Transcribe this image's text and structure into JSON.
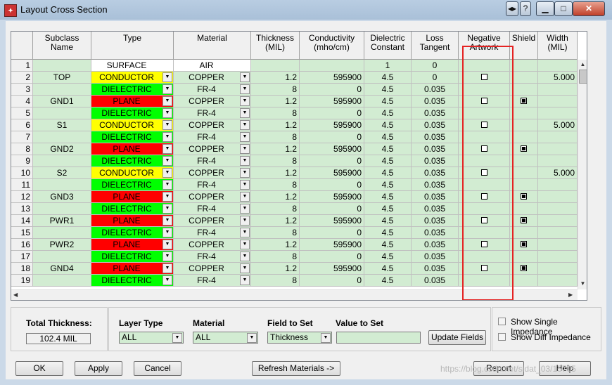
{
  "window": {
    "title": "Layout Cross Section"
  },
  "columns": [
    "Subclass Name",
    "Type",
    "Material",
    "Thickness\n(MIL)",
    "Conductivity\n(mho/cm)",
    "Dielectric\nConstant",
    "Loss\nTangent",
    "Negative\nArtwork",
    "Shield",
    "Width\n(MIL)"
  ],
  "rows": [
    {
      "n": "1",
      "name": "",
      "type": "SURFACE",
      "material": "AIR",
      "thick": "",
      "cond": "",
      "diel": "1",
      "loss": "0",
      "neg": null,
      "shield": null,
      "width": ""
    },
    {
      "n": "2",
      "name": "TOP",
      "type": "CONDUCTOR",
      "material": "COPPER",
      "thick": "1.2",
      "cond": "595900",
      "diel": "4.5",
      "loss": "0",
      "neg": false,
      "shield": null,
      "width": "5.000"
    },
    {
      "n": "3",
      "name": "",
      "type": "DIELECTRIC",
      "material": "FR-4",
      "thick": "8",
      "cond": "0",
      "diel": "4.5",
      "loss": "0.035",
      "neg": null,
      "shield": null,
      "width": ""
    },
    {
      "n": "4",
      "name": "GND1",
      "type": "PLANE",
      "material": "COPPER",
      "thick": "1.2",
      "cond": "595900",
      "diel": "4.5",
      "loss": "0.035",
      "neg": false,
      "shield": true,
      "width": ""
    },
    {
      "n": "5",
      "name": "",
      "type": "DIELECTRIC",
      "material": "FR-4",
      "thick": "8",
      "cond": "0",
      "diel": "4.5",
      "loss": "0.035",
      "neg": null,
      "shield": null,
      "width": ""
    },
    {
      "n": "6",
      "name": "S1",
      "type": "CONDUCTOR",
      "material": "COPPER",
      "thick": "1.2",
      "cond": "595900",
      "diel": "4.5",
      "loss": "0.035",
      "neg": false,
      "shield": null,
      "width": "5.000"
    },
    {
      "n": "7",
      "name": "",
      "type": "DIELECTRIC",
      "material": "FR-4",
      "thick": "8",
      "cond": "0",
      "diel": "4.5",
      "loss": "0.035",
      "neg": null,
      "shield": null,
      "width": ""
    },
    {
      "n": "8",
      "name": "GND2",
      "type": "PLANE",
      "material": "COPPER",
      "thick": "1.2",
      "cond": "595900",
      "diel": "4.5",
      "loss": "0.035",
      "neg": false,
      "shield": true,
      "width": ""
    },
    {
      "n": "9",
      "name": "",
      "type": "DIELECTRIC",
      "material": "FR-4",
      "thick": "8",
      "cond": "0",
      "diel": "4.5",
      "loss": "0.035",
      "neg": null,
      "shield": null,
      "width": ""
    },
    {
      "n": "10",
      "name": "S2",
      "type": "CONDUCTOR",
      "material": "COPPER",
      "thick": "1.2",
      "cond": "595900",
      "diel": "4.5",
      "loss": "0.035",
      "neg": false,
      "shield": null,
      "width": "5.000"
    },
    {
      "n": "11",
      "name": "",
      "type": "DIELECTRIC",
      "material": "FR-4",
      "thick": "8",
      "cond": "0",
      "diel": "4.5",
      "loss": "0.035",
      "neg": null,
      "shield": null,
      "width": ""
    },
    {
      "n": "12",
      "name": "GND3",
      "type": "PLANE",
      "material": "COPPER",
      "thick": "1.2",
      "cond": "595900",
      "diel": "4.5",
      "loss": "0.035",
      "neg": false,
      "shield": true,
      "width": ""
    },
    {
      "n": "13",
      "name": "",
      "type": "DIELECTRIC",
      "material": "FR-4",
      "thick": "8",
      "cond": "0",
      "diel": "4.5",
      "loss": "0.035",
      "neg": null,
      "shield": null,
      "width": ""
    },
    {
      "n": "14",
      "name": "PWR1",
      "type": "PLANE",
      "material": "COPPER",
      "thick": "1.2",
      "cond": "595900",
      "diel": "4.5",
      "loss": "0.035",
      "neg": false,
      "shield": true,
      "width": ""
    },
    {
      "n": "15",
      "name": "",
      "type": "DIELECTRIC",
      "material": "FR-4",
      "thick": "8",
      "cond": "0",
      "diel": "4.5",
      "loss": "0.035",
      "neg": null,
      "shield": null,
      "width": ""
    },
    {
      "n": "16",
      "name": "PWR2",
      "type": "PLANE",
      "material": "COPPER",
      "thick": "1.2",
      "cond": "595900",
      "diel": "4.5",
      "loss": "0.035",
      "neg": false,
      "shield": true,
      "width": ""
    },
    {
      "n": "17",
      "name": "",
      "type": "DIELECTRIC",
      "material": "FR-4",
      "thick": "8",
      "cond": "0",
      "diel": "4.5",
      "loss": "0.035",
      "neg": null,
      "shield": null,
      "width": ""
    },
    {
      "n": "18",
      "name": "GND4",
      "type": "PLANE",
      "material": "COPPER",
      "thick": "1.2",
      "cond": "595900",
      "diel": "4.5",
      "loss": "0.035",
      "neg": false,
      "shield": true,
      "width": ""
    },
    {
      "n": "19",
      "name": "",
      "type": "DIELECTRIC",
      "material": "FR-4",
      "thick": "8",
      "cond": "0",
      "diel": "4.5",
      "loss": "0.035",
      "neg": null,
      "shield": null,
      "width": ""
    }
  ],
  "bottom": {
    "total_label": "Total Thickness:",
    "total_value": "102.4 MIL",
    "layer_type_label": "Layer Type",
    "layer_type_value": "ALL",
    "material_label": "Material",
    "material_value": "ALL",
    "field_label": "Field to Set",
    "field_value": "Thickness",
    "value_label": "Value to Set",
    "value_value": "",
    "update_button": "Update Fields",
    "show_single": "Show Single Impedance",
    "show_diff": "Show Diff Impedance"
  },
  "buttons": {
    "ok": "OK",
    "apply": "Apply",
    "cancel": "Cancel",
    "refresh": "Refresh Materials ->",
    "report": "Report",
    "help": "Help"
  },
  "watermark": "https://blog.csdn.net/sidat_03/15705",
  "colors": {
    "conductor": "#ffff00",
    "dielectric": "#00ff00",
    "plane": "#ff0000",
    "cell_green": "#d2ecd2",
    "highlight": "#e52222"
  }
}
